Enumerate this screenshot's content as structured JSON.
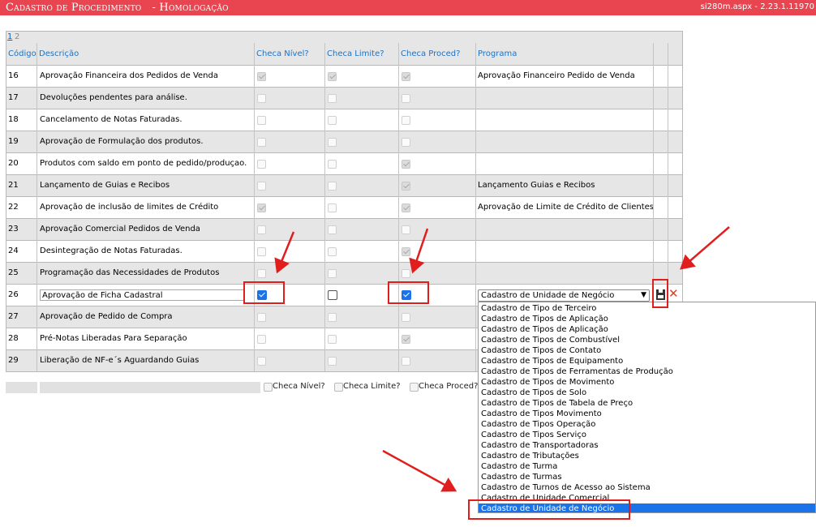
{
  "header": {
    "title": "Cadastro de Procedimento   - Homologação",
    "version": "si280m.aspx - 2.23.1.11970"
  },
  "pager": {
    "pages": [
      "1",
      "2"
    ]
  },
  "columns": {
    "codigo": "Código",
    "descricao": "Descrição",
    "checa_nivel": "Checa Nível?",
    "checa_limite": "Checa Limite?",
    "checa_proced": "Checa Proced?",
    "programa": "Programa"
  },
  "rows": [
    {
      "code": "16",
      "desc": "Aprovação Financeira dos Pedidos de Venda",
      "nivel": true,
      "limite": true,
      "proced": true,
      "programa": "Aprovação Financeiro Pedido de Venda"
    },
    {
      "code": "17",
      "desc": "Devoluções pendentes para análise.",
      "nivel": false,
      "limite": false,
      "proced": false,
      "programa": ""
    },
    {
      "code": "18",
      "desc": "Cancelamento de Notas Faturadas.",
      "nivel": false,
      "limite": false,
      "proced": false,
      "programa": ""
    },
    {
      "code": "19",
      "desc": "Aprovação de Formulação dos produtos.",
      "nivel": false,
      "limite": false,
      "proced": false,
      "programa": ""
    },
    {
      "code": "20",
      "desc": "Produtos com saldo em ponto de pedido/produçao.",
      "nivel": false,
      "limite": false,
      "proced": true,
      "programa": ""
    },
    {
      "code": "21",
      "desc": "Lançamento de Guias e Recibos",
      "nivel": false,
      "limite": false,
      "proced": true,
      "programa": "Lançamento Guias e Recibos"
    },
    {
      "code": "22",
      "desc": "Aprovação de inclusão de limites de Crédito",
      "nivel": true,
      "limite": false,
      "proced": true,
      "programa": "Aprovação de Limite de Crédito de Clientes"
    },
    {
      "code": "23",
      "desc": "Aprovação Comercial Pedidos de Venda",
      "nivel": false,
      "limite": false,
      "proced": false,
      "programa": ""
    },
    {
      "code": "24",
      "desc": "Desintegração de Notas Faturadas.",
      "nivel": false,
      "limite": false,
      "proced": true,
      "programa": ""
    },
    {
      "code": "25",
      "desc": "Programação das Necessidades de Produtos",
      "nivel": false,
      "limite": false,
      "proced": false,
      "programa": ""
    },
    {
      "code": "26",
      "desc": "Aprovação de Ficha Cadastral",
      "nivel": true,
      "limite": false,
      "proced": true,
      "programa": "Cadastro de Unidade de Negócio",
      "editing": true
    },
    {
      "code": "27",
      "desc": "Aprovação de Pedido de Compra",
      "nivel": false,
      "limite": false,
      "proced": false,
      "programa": ""
    },
    {
      "code": "28",
      "desc": "Pré-Notas Liberadas Para Separação",
      "nivel": false,
      "limite": false,
      "proced": true,
      "programa": ""
    },
    {
      "code": "29",
      "desc": "Liberação de NF-e´s Aguardando Guias",
      "nivel": false,
      "limite": false,
      "proced": false,
      "programa": ""
    }
  ],
  "footer": {
    "checa_nivel": "Checa Nível?",
    "checa_limite": "Checa Limite?",
    "checa_proced": "Checa Proced?"
  },
  "dropdown": {
    "options": [
      "Cadastro de Tipo de Terceiro",
      "Cadastro de Tipos de Aplicação",
      "Cadastro de Tipos de Aplicação",
      "Cadastro de Tipos de Combustível",
      "Cadastro de Tipos de Contato",
      "Cadastro de Tipos de Equipamento",
      "Cadastro de Tipos de Ferramentas de Produção",
      "Cadastro de Tipos de Movimento",
      "Cadastro de Tipos de Solo",
      "Cadastro de Tipos de Tabela de Preço",
      "Cadastro de Tipos Movimento",
      "Cadastro de Tipos Operação",
      "Cadastro de Tipos Serviço",
      "Cadastro de Transportadoras",
      "Cadastro de Tributações",
      "Cadastro de Turma",
      "Cadastro de Turmas",
      "Cadastro de Turnos de Acesso ao Sistema",
      "Cadastro de Unidade Comercial",
      "Cadastro de Unidade de Negócio"
    ],
    "selected_index": 19
  },
  "colors": {
    "header_bg": "#e84550",
    "link": "#1f72c0",
    "highlight": "#e01e1e",
    "selection": "#1a73e8"
  }
}
